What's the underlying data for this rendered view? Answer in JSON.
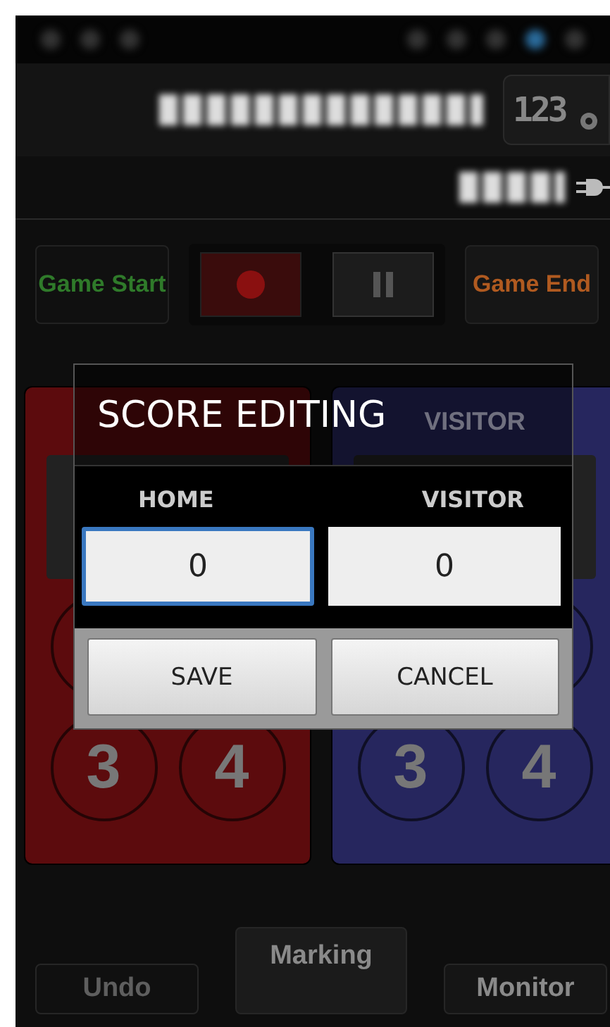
{
  "header": {
    "settings_label": "123"
  },
  "controls": [
    {
      "kind": "start",
      "label": "Game Start",
      "disabled": true
    },
    {
      "kind": "record"
    },
    {
      "kind": "pause"
    },
    {
      "kind": "end",
      "label": "Game End",
      "disabled": false
    }
  ],
  "teams": [
    {
      "color": "#5c0b0d",
      "buttons": [
        "3",
        "4"
      ]
    },
    {
      "color": "#26265e",
      "name": "VISITOR",
      "buttons": [
        "3",
        "4"
      ]
    }
  ],
  "dialog": {
    "title": "SCORE EDITING",
    "fields": [
      {
        "label": "HOME",
        "value": "0",
        "selected": true
      },
      {
        "label": "VISITOR",
        "value": "0",
        "selected": false
      }
    ],
    "buttons": [
      "SAVE",
      "CANCEL"
    ]
  },
  "bottom_buttons": [
    {
      "label": "Undo",
      "disabled": true,
      "raised": false
    },
    {
      "label": "Marking",
      "disabled": false,
      "raised": true
    },
    {
      "label": "Monitor",
      "disabled": false,
      "raised": false
    }
  ]
}
